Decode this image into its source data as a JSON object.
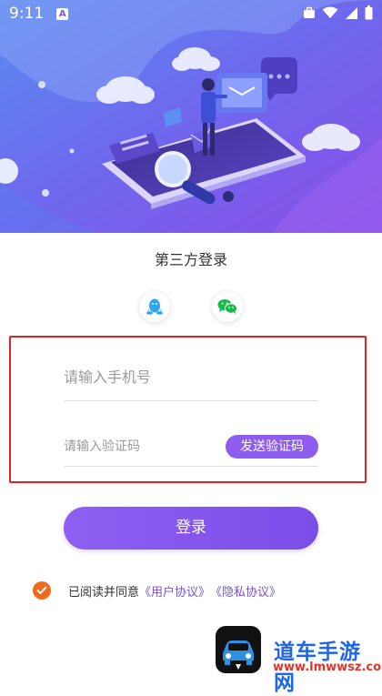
{
  "status_bar": {
    "time": "9:11",
    "left_icon": "notification-a-icon",
    "right_icons": [
      "briefcase-icon",
      "wifi-icon",
      "signal-icon",
      "battery-icon"
    ]
  },
  "hero": {
    "illustration": "online-office-illustration"
  },
  "third_party": {
    "title": "第三方登录",
    "buttons": [
      {
        "name": "qq",
        "icon": "qq-penguin-icon",
        "color": "#2ea7f0"
      },
      {
        "name": "wechat",
        "icon": "wechat-icon",
        "color": "#19b94c"
      }
    ]
  },
  "form": {
    "phone_placeholder": "请输入手机号",
    "phone_value": "",
    "code_placeholder": "请输入验证码",
    "code_value": "",
    "send_code_label": "发送验证码",
    "highlight_color": "#e02424"
  },
  "login": {
    "label": "登录",
    "color": "#8a5cf0"
  },
  "agreement": {
    "checked": true,
    "text": "已阅读并同意",
    "user_link": "《用户协议》",
    "privacy_link": "《隐私协议》",
    "check_color": "#f06a1c"
  },
  "watermark": {
    "title": "道车手游网",
    "subtitle": "www.lmwwsz.com"
  }
}
